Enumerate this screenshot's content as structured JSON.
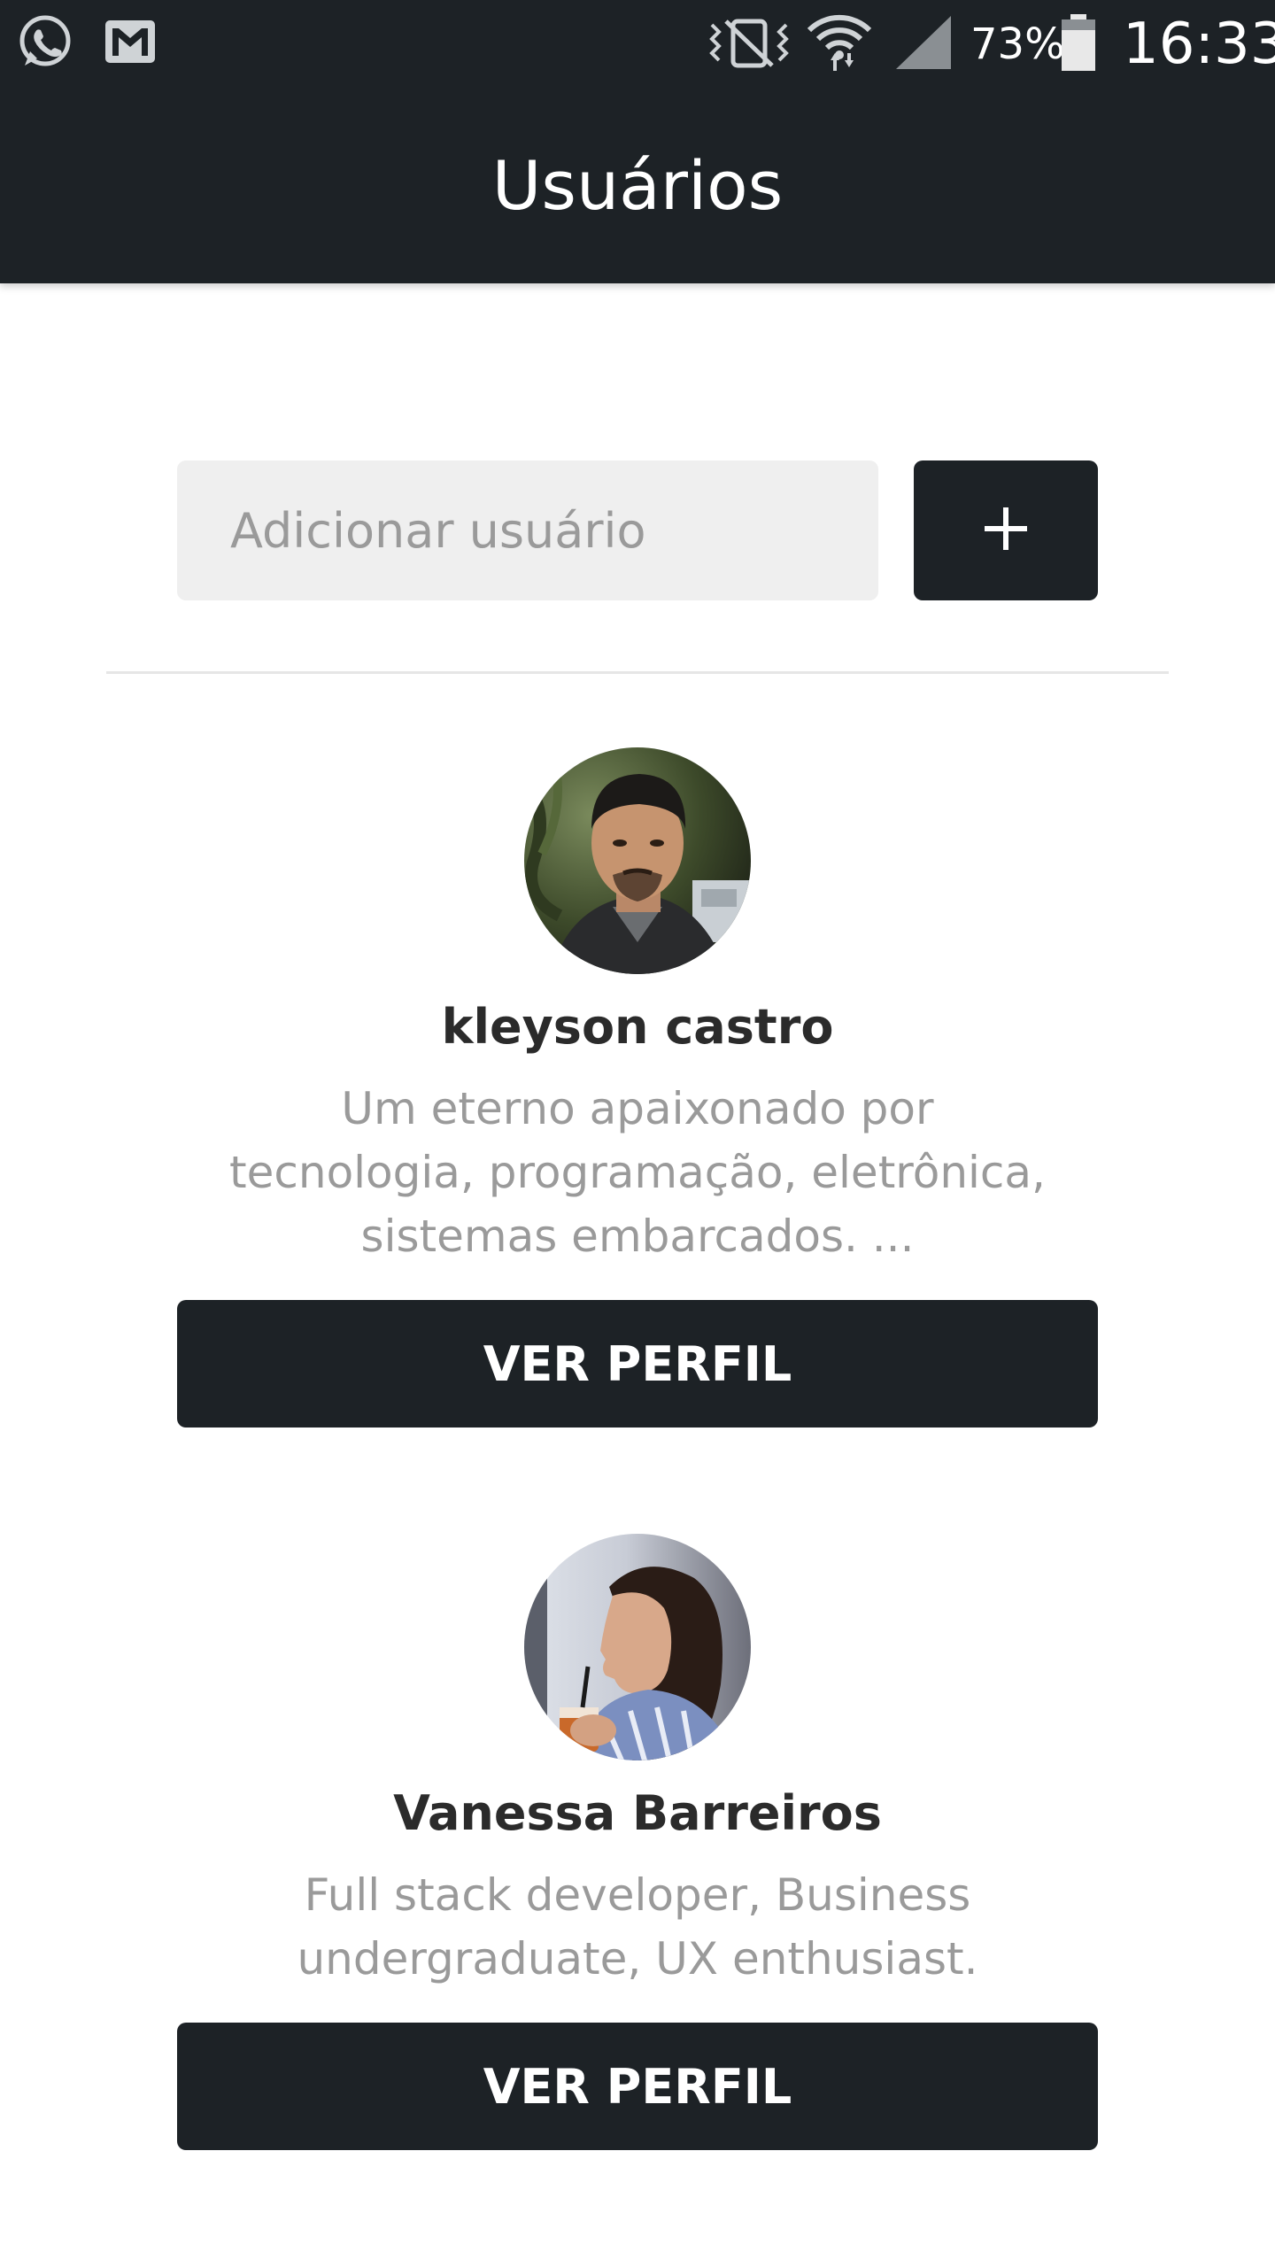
{
  "status_bar": {
    "battery_percent": "73%",
    "time": "16:33",
    "icons": [
      "whatsapp-icon",
      "gmail-icon",
      "vibrate-icon",
      "wifi-icon",
      "signal-icon",
      "battery-icon"
    ]
  },
  "toolbar": {
    "title": "Usuários"
  },
  "add_user": {
    "placeholder": "Adicionar usuário",
    "value": "",
    "button_icon": "plus-icon"
  },
  "users": [
    {
      "name": "kleyson castro",
      "bio": "Um eterno apaixonado por tecnologia, programação, eletrônica, sistemas embarcados. ...",
      "button_label": "VER PERFIL"
    },
    {
      "name": "Vanessa Barreiros",
      "bio": "Full stack developer, Business undergraduate, UX enthusiast.",
      "button_label": "VER PERFIL"
    }
  ],
  "colors": {
    "primary_dark": "#1d2226",
    "input_bg": "#efefef",
    "text_muted": "#9a9a9a",
    "text_dark": "#2b2b2b"
  }
}
